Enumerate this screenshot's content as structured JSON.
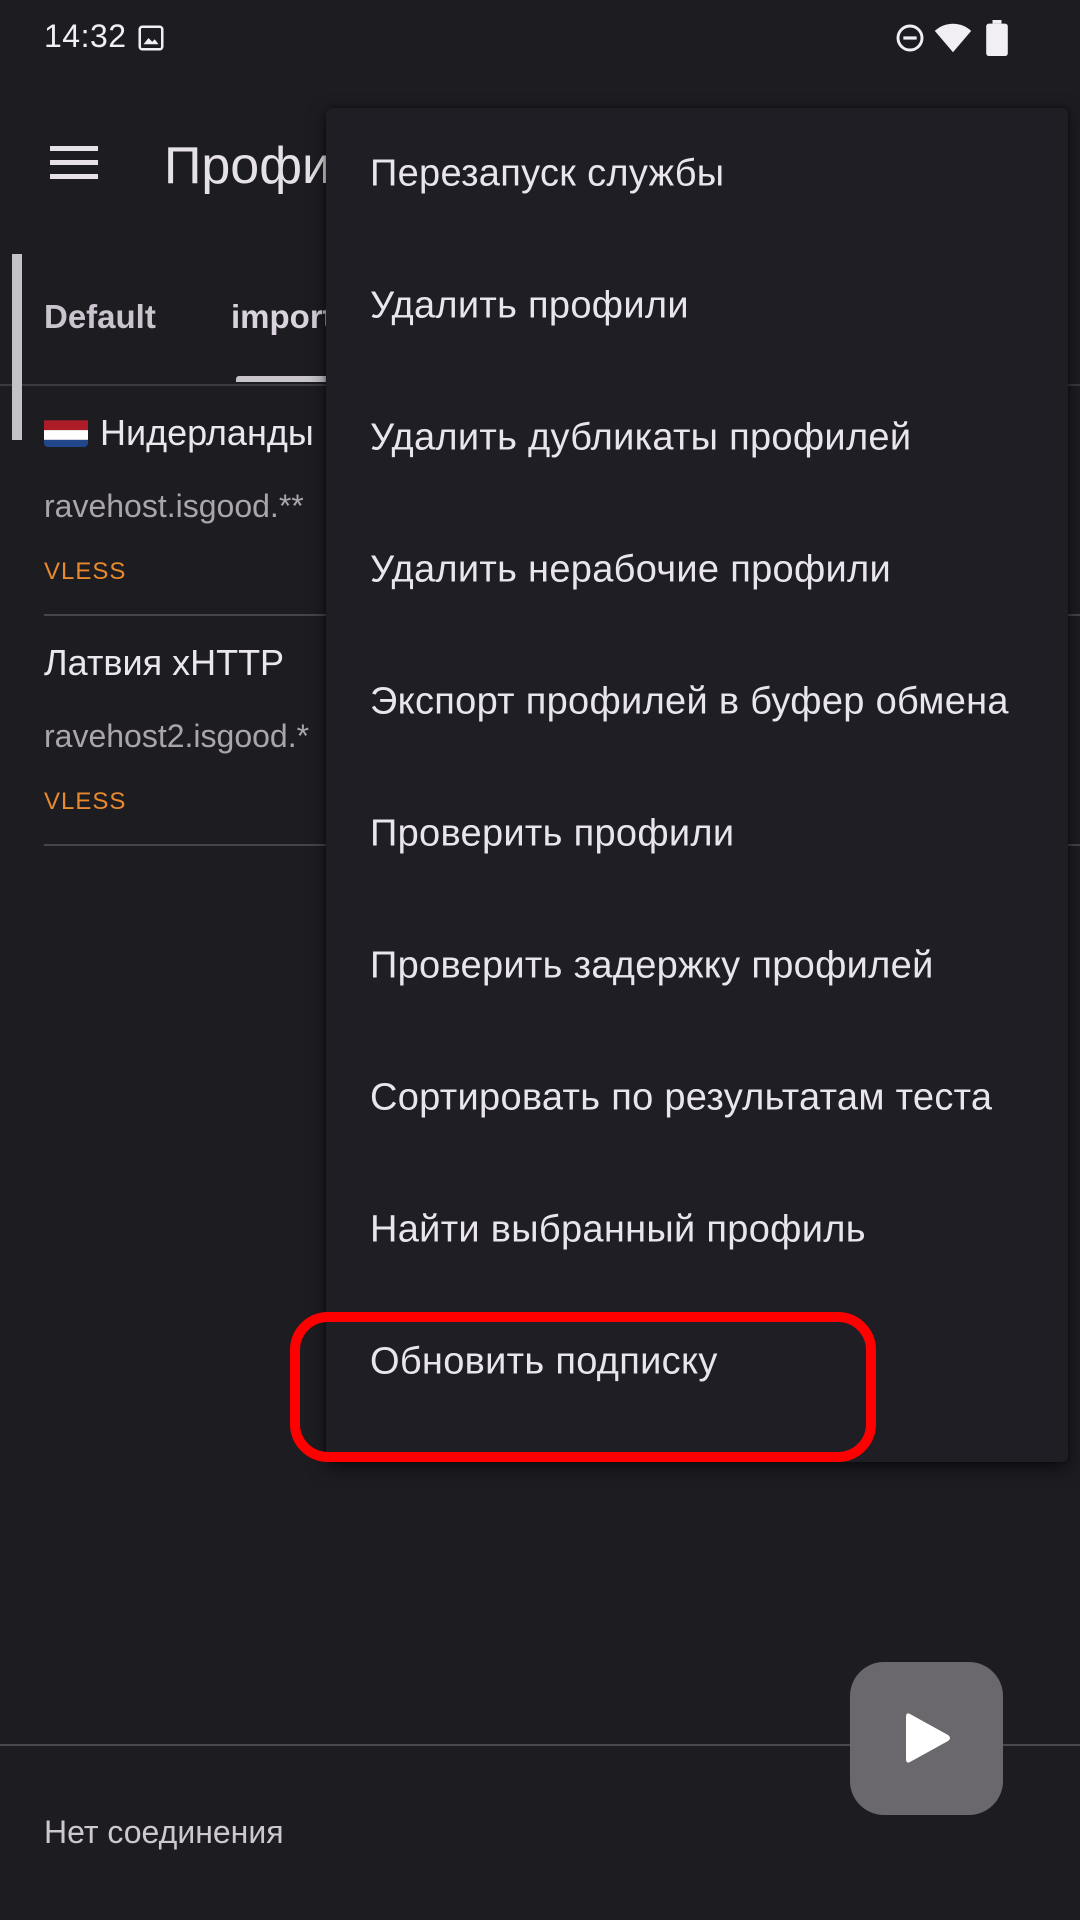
{
  "status_bar": {
    "time": "14:32",
    "icons": [
      "image-icon",
      "do-not-disturb-icon",
      "wifi-icon",
      "battery-icon"
    ]
  },
  "app_bar": {
    "title": "Профи",
    "menu_icon": "hamburger-menu-icon"
  },
  "tabs": [
    {
      "label": "Default",
      "selected": false
    },
    {
      "label": "import",
      "selected": true
    }
  ],
  "profiles": [
    {
      "flag": "netherlands-flag",
      "name": "Нидерланды",
      "host": "ravehost.isgood.**",
      "type": "VLESS",
      "selected": false
    },
    {
      "flag": "",
      "name": "Латвия xHTTP",
      "host": "ravehost2.isgood.*",
      "type": "VLESS",
      "selected": true
    }
  ],
  "menu": {
    "items": [
      {
        "label": "Перезапуск службы"
      },
      {
        "label": "Удалить профили"
      },
      {
        "label": "Удалить дубликаты профилей"
      },
      {
        "label": "Удалить нерабочие профили"
      },
      {
        "label": "Экспорт профилей в буфер обмена"
      },
      {
        "label": "Проверить профили"
      },
      {
        "label": "Проверить задержку профилей"
      },
      {
        "label": "Сортировать по результатам теста"
      },
      {
        "label": "Найти выбранный профиль"
      },
      {
        "label": "Обновить подписку",
        "highlighted": true
      }
    ]
  },
  "connection_status": "Нет соединения",
  "fab": {
    "icon": "play-icon"
  },
  "colors": {
    "background": "#1d1c21",
    "menu_background": "#1f1e24",
    "protocol_badge": "#e8892e",
    "highlight": "#ff0000",
    "fab": "#6a686c"
  }
}
